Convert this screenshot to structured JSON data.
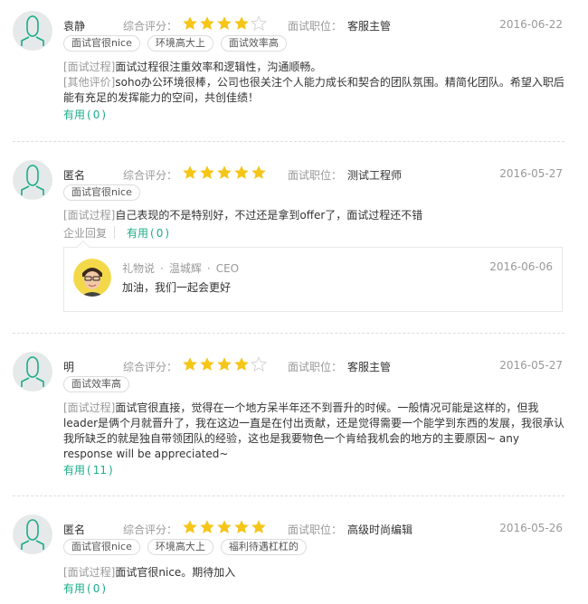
{
  "colors": {
    "star": "#f5c518",
    "star_empty": "#d4d4d4",
    "accent": "#1aac8a",
    "avatar_line": "#1aac8a"
  },
  "labels": {
    "rating": "综合评分：",
    "position": "面试职位：",
    "process": "[面试过程]",
    "other": "[其他评价]",
    "company_reply": "企业回复",
    "helpful": "有用"
  },
  "reviews": [
    {
      "name": "袁静",
      "rating": 4,
      "position": "客服主管",
      "date": "2016-06-22",
      "tags": [
        "面试官很nice",
        "环境高大上",
        "面试效率高"
      ],
      "process": "面试过程很注重效率和逻辑性，沟通顺畅。",
      "other": "soho办公环境很棒，公司也很关注个人能力成长和契合的团队氛围。精简化团队。希望入职后能有充足的发挥能力的空间，共创佳绩！",
      "helpful": "0"
    },
    {
      "name": "匿名",
      "rating": 5,
      "position": "测试工程师",
      "date": "2016-05-27",
      "tags": [
        "面试官很nice"
      ],
      "process": "自己表现的不是特别好，不过还是拿到offer了，面试过程还不错",
      "helpful": "0",
      "reply": {
        "company": "礼物说",
        "person": "温城辉",
        "title": "CEO",
        "date": "2016-06-06",
        "text": "加油，我们一起会更好"
      }
    },
    {
      "name": "明",
      "rating": 4,
      "position": "客服主管",
      "date": "2016-05-27",
      "tags": [
        "面试效率高"
      ],
      "process": "面试官很直接，觉得在一个地方呆半年还不到晋升的时候。一般情况可能是这样的，但我leader是俩个月就晋升了，我在这边一直是在付出贡献，还是觉得需要一个能学到东西的发展，我很承认我所缺乏的就是独自带领团队的经验，这也是我要物色一个肯给我机会的地方的主要原因~ any response will be appreciated~",
      "helpful": "11"
    },
    {
      "name": "匿名",
      "rating": 5,
      "position": "高级时尚编辑",
      "date": "2016-05-26",
      "tags": [
        "面试官很nice",
        "环境高大上",
        "福利待遇杠杠的"
      ],
      "process": "面试官很nice。期待加入",
      "helpful": "0"
    }
  ]
}
